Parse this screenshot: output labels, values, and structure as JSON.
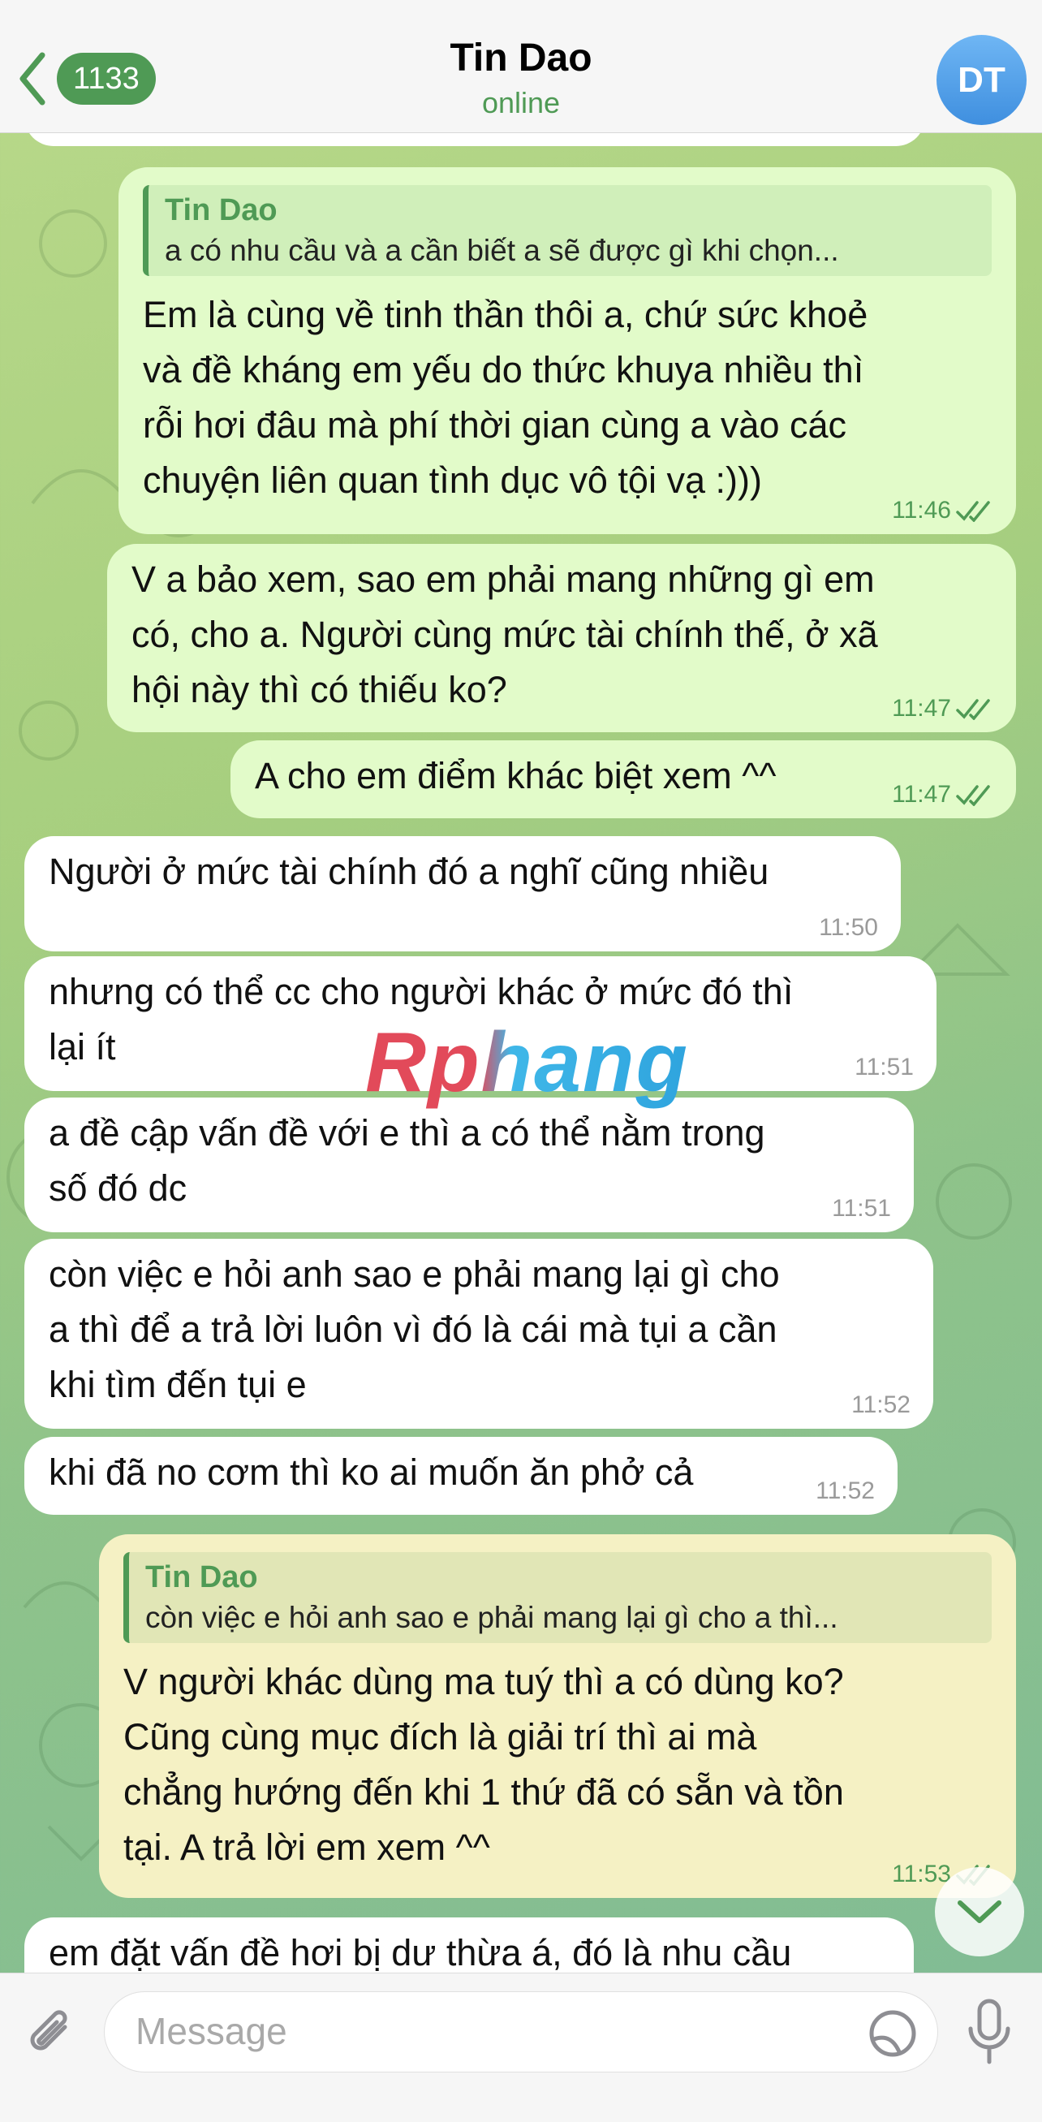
{
  "header": {
    "back_count": "1133",
    "contact_name": "Tin Dao",
    "status": "online",
    "avatar_initials": "DT"
  },
  "messages": [
    {
      "direction": "outgoing",
      "reply_to": {
        "name": "Tin Dao",
        "text": "a có nhu cầu và a cần biết a sẽ được gì khi chọn..."
      },
      "lines": [
        "Em là cùng về tinh thần thôi a, chứ sức khoẻ",
        "và đề kháng em yếu do thức khuya nhiều thì",
        "rỗi hơi đâu mà phí thời gian cùng a vào các",
        "chuyện liên quan tình dục vô tội vạ :)))"
      ],
      "time": "11:46",
      "read": true
    },
    {
      "direction": "outgoing",
      "lines": [
        "V a bảo xem, sao em phải mang những gì em",
        "có, cho a. Người cùng mức tài chính thế, ở xã",
        "hội này thì có thiếu ko?"
      ],
      "time": "11:47",
      "read": true
    },
    {
      "direction": "outgoing",
      "lines": [
        "A cho em điểm khác biệt xem ^^"
      ],
      "time": "11:47",
      "read": true
    },
    {
      "direction": "incoming",
      "lines": [
        "Người ở mức tài chính đó a nghĩ cũng nhiều"
      ],
      "time": "11:50"
    },
    {
      "direction": "incoming",
      "lines": [
        "nhưng có thể cc cho người khác ở mức đó thì",
        "lại ít"
      ],
      "time": "11:51"
    },
    {
      "direction": "incoming",
      "lines": [
        "a đề cập vấn đề với e thì a có thể nằm trong",
        "số đó dc"
      ],
      "time": "11:51"
    },
    {
      "direction": "incoming",
      "lines": [
        "còn việc e hỏi anh sao e phải mang lại gì cho",
        "a thì để a trả lời luôn vì đó là cái mà tụi a cần",
        "khi tìm đến tụi e"
      ],
      "time": "11:52"
    },
    {
      "direction": "incoming",
      "lines": [
        "khi đã no cơm thì ko ai muốn ăn phở cả"
      ],
      "time": "11:52"
    },
    {
      "direction": "outgoing",
      "reply_to": {
        "name": "Tin Dao",
        "text": "còn việc e hỏi anh sao e phải mang lại gì cho a thì..."
      },
      "lines": [
        "V người khác dùng ma tuý thì a có dùng ko?",
        "Cũng cùng mục đích là giải trí thì ai mà",
        "chẳng hướng đến khi 1 thứ đã có sẵn và tồn",
        "tại. A trả lời em xem ^^"
      ],
      "time": "11:53",
      "read": true
    },
    {
      "direction": "incoming",
      "lines": [
        "em đặt vấn đề hơi bị dư thừa á, đó là nhu cầu"
      ],
      "time": ""
    }
  ],
  "watermark": "Rphang",
  "composer": {
    "placeholder": "Message"
  },
  "icons": {
    "back": "chevron-left-icon",
    "attach": "paperclip-icon",
    "sticker": "sticker-icon",
    "mic": "microphone-icon",
    "scroll_down": "chevron-down-icon"
  },
  "colors": {
    "accent": "#4f9a55",
    "outgoing_bubble": "#e2fbc9",
    "incoming_bubble": "#ffffff"
  }
}
